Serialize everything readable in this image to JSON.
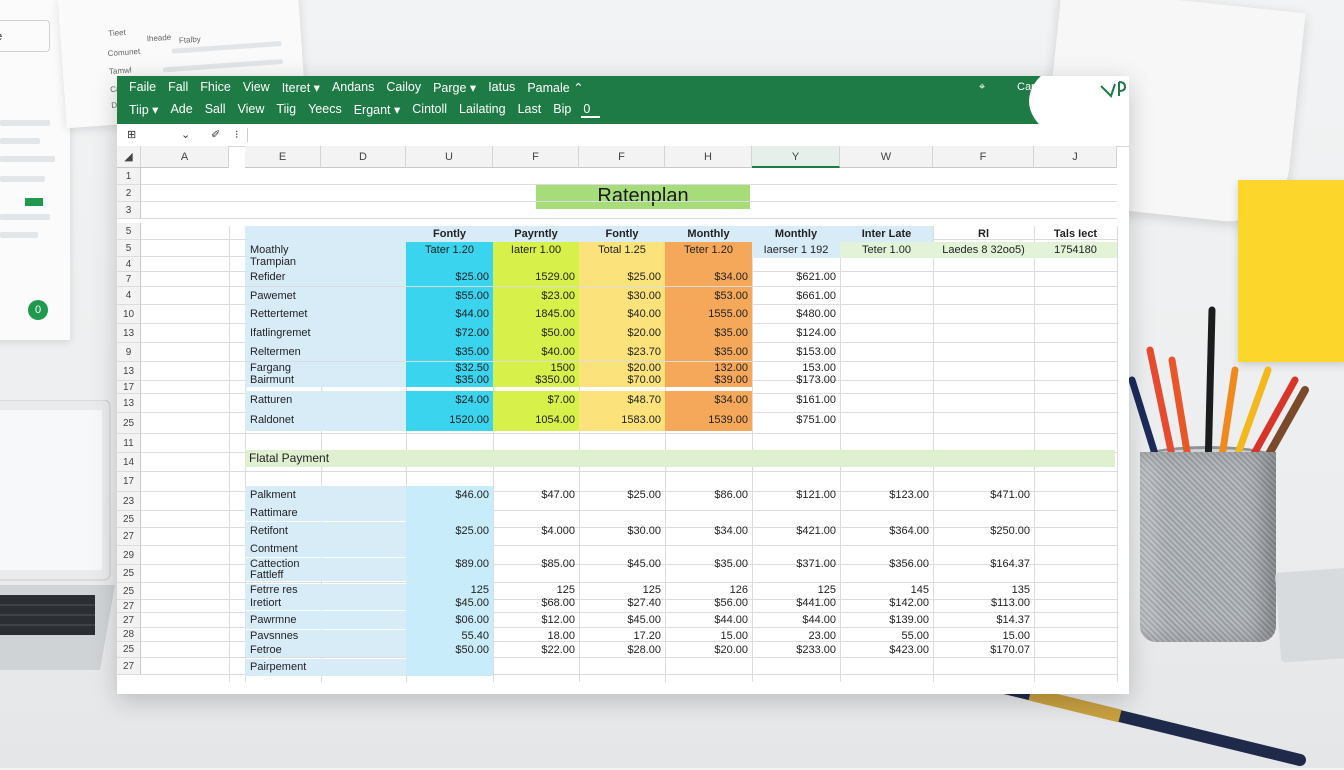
{
  "menu_row1": [
    "Faile",
    "Fall",
    "Fhice",
    "View",
    "Iteret ▾",
    "Andans",
    "Cailoy",
    "Parge ▾",
    "Iatus",
    "Pamale ⌃"
  ],
  "menu_row2": [
    "Tiip ▾",
    "Ade",
    "Sall",
    "View",
    "Tiig",
    "Yeecs",
    "Ergant ▾",
    "Cintoll",
    "Lailating",
    "Last",
    "Bip",
    "0"
  ],
  "ribbon_right": {
    "share": "Carne",
    "pin": "⌖"
  },
  "formula_bar": {
    "name_box": "⊞",
    "dropdown": "⌄",
    "fx": "✐",
    "more": "⁝"
  },
  "column_headers": [
    "A",
    "E",
    "D",
    "U",
    "F",
    "F",
    "H",
    "Y",
    "W",
    "F",
    "J"
  ],
  "row_headers": [
    "1",
    "2",
    "3",
    "5",
    "5",
    "4",
    "7",
    "4",
    "10",
    "13",
    "9",
    "13",
    "17",
    "13",
    "25",
    "11",
    "14",
    "17",
    "23",
    "25",
    "27",
    "29",
    "25",
    "25",
    "27",
    "27",
    "28",
    "25",
    "27"
  ],
  "sheet_title": "Ratenplan",
  "table1": {
    "headers": [
      "Fontly",
      "Payrntly",
      "Fontly",
      "Monthly",
      "Monthly",
      "Inter Late",
      "Rl",
      "Tals Iect"
    ],
    "header_row_label": "Moathly",
    "subheaders": [
      "Tater 1.20",
      "Iaterr 1.00",
      "Total 1.25",
      "Teter 1.20",
      "Iaerser 1 192",
      "Teter 1.00",
      "Laedes 8 32oo5)",
      "1754180"
    ],
    "rows": [
      {
        "label": "Trampian",
        "values": [
          "",
          "",
          "",
          "",
          ""
        ]
      },
      {
        "label": "Refider",
        "values": [
          "$25.00",
          "1529.00",
          "$25.00",
          "$34.00",
          "$621.00"
        ]
      },
      {
        "label": "Pawemet",
        "values": [
          "$55.00",
          "$23.00",
          "$30.00",
          "$53.00",
          "$661.00"
        ]
      },
      {
        "label": "Rettertemet",
        "values": [
          "$44.00",
          "1845.00",
          "$40.00",
          "1555.00",
          "$480.00"
        ]
      },
      {
        "label": "Ifatlingremet",
        "values": [
          "$72.00",
          "$50.00",
          "$20.00",
          "$35.00",
          "$124.00"
        ]
      },
      {
        "label": "Reltermen",
        "values": [
          "$35.00",
          "$40.00",
          "$23.70",
          "$35.00",
          "$153.00"
        ]
      },
      {
        "label": "Fargang",
        "values": [
          "$32.50",
          "1500",
          "$20.00",
          "132.00",
          "153.00"
        ]
      },
      {
        "label": "Bairmunt",
        "values": [
          "$35.00",
          "$350.00",
          "$70.00",
          "$39.00",
          "$173.00"
        ]
      },
      {
        "label": "Ratturen",
        "values": [
          "$24.00",
          "$7.00",
          "$48.70",
          "$34.00",
          "$161.00"
        ]
      },
      {
        "label": "Raldonet",
        "values": [
          "1520.00",
          "1054.00",
          "1583.00",
          "1539.00",
          "$751.00"
        ]
      }
    ]
  },
  "section2_title": "Flatal Payment",
  "table2": {
    "rows": [
      {
        "label": "Palkment",
        "values": [
          "$46.00",
          "$47.00",
          "$25.00",
          "$86.00",
          "$121.00",
          "$123.00",
          "$471.00"
        ]
      },
      {
        "label": "Rattimare",
        "values": [
          "",
          "",
          "",
          "",
          "",
          "",
          ""
        ]
      },
      {
        "label": "Retifont",
        "values": [
          "$25.00",
          "$4.000",
          "$30.00",
          "$34.00",
          "$421.00",
          "$364.00",
          "$250.00"
        ]
      },
      {
        "label": "Contment",
        "values": [
          "",
          "",
          "",
          "",
          "",
          "",
          ""
        ]
      },
      {
        "label": "Cattection",
        "values": [
          "$89.00",
          "$85.00",
          "$45.00",
          "$35.00",
          "$371.00",
          "$356.00",
          "$164.37"
        ]
      },
      {
        "label": "Fattleff",
        "values": [
          "",
          "",
          "",
          "",
          "",
          "",
          ""
        ]
      },
      {
        "label": "Fetrre res",
        "values": [
          "125",
          "125",
          "125",
          "126",
          "125",
          "145",
          "135"
        ]
      },
      {
        "label": "Iretiort",
        "values": [
          "$45.00",
          "$68.00",
          "$27.40",
          "$56.00",
          "$441.00",
          "$142.00",
          "$113.00"
        ]
      },
      {
        "label": "Pawrmne",
        "values": [
          "$06.00",
          "$12.00",
          "$45.00",
          "$44.00",
          "$44.00",
          "$139.00",
          "$14.37"
        ]
      },
      {
        "label": "Pavsnnes",
        "values": [
          "55.40",
          "18.00",
          "17.20",
          "15.00",
          "23.00",
          "55.00",
          "15.00"
        ]
      },
      {
        "label": "Fetroe",
        "values": [
          "$50.00",
          "$22.00",
          "$28.00",
          "$20.00",
          "$233.00",
          "$423.00",
          "$170.07"
        ]
      },
      {
        "label": "Pairpement",
        "values": [
          "",
          "",
          "",
          "",
          "",
          "",
          ""
        ]
      }
    ]
  },
  "paper_text": [
    "Tieet",
    "Iheade",
    "Ftalby",
    "Comunet",
    "Tamwl",
    "Cain",
    "Drae"
  ],
  "paper_box": "le",
  "paper_badge": "0",
  "colors": {
    "ribbon": "#1e7b45",
    "title_bg": "#a7dc7b",
    "cyan": "#3ad4ee",
    "lime": "#d7f04a",
    "yellow": "#fbe27b",
    "orange": "#f6a85a"
  }
}
